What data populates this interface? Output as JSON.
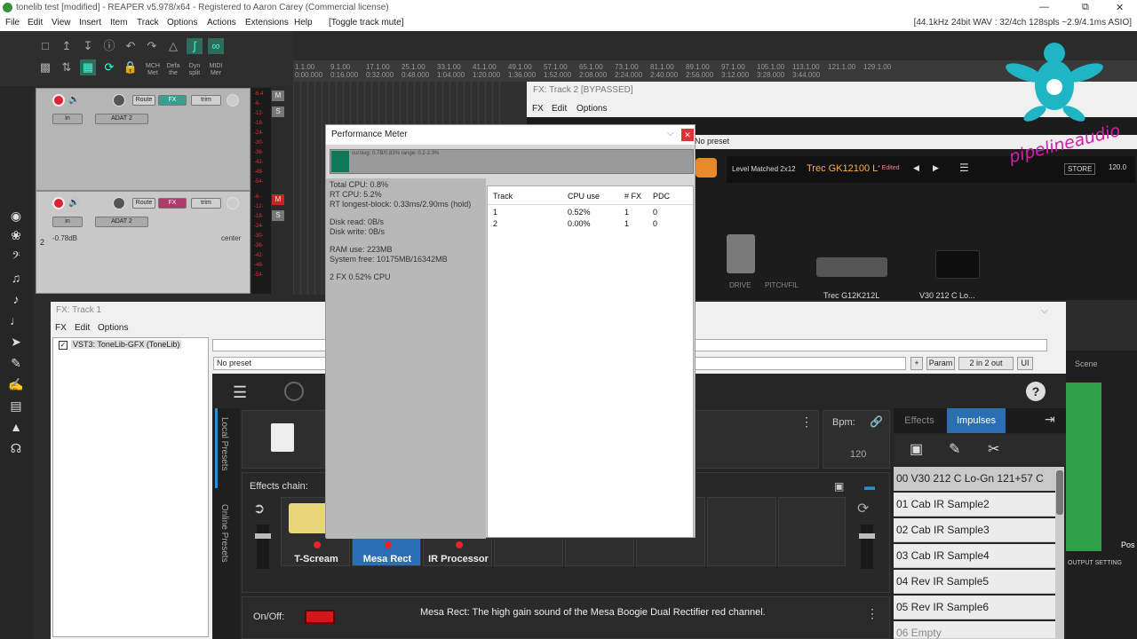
{
  "app": {
    "title": "tonelib test [modified] - REAPER v5.978/x64 - Registered to Aaron Carey (Commercial license)",
    "status": "[44.1kHz 24bit WAV : 32/4ch 128spls ~2.9/4.1ms ASIO]"
  },
  "menu": [
    "File",
    "Edit",
    "View",
    "Insert",
    "Item",
    "Track",
    "Options",
    "Actions",
    "Extensions",
    "Help",
    "[Toggle track mute]"
  ],
  "toolbar": {
    "mch": "MCH Met",
    "defa": "Defa the",
    "dyn": "Dyn split",
    "midi": "MIDI Mer"
  },
  "timeline": {
    "ticks": [
      {
        "bar": "1.1.00",
        "time": "0:00.000"
      },
      {
        "bar": "9.1.00",
        "time": "0:16.000"
      },
      {
        "bar": "17.1.00",
        "time": "0:32.000"
      },
      {
        "bar": "25.1.00",
        "time": "0:48.000"
      },
      {
        "bar": "33.1.00",
        "time": "1:04.000"
      },
      {
        "bar": "41.1.00",
        "time": "1:20.000"
      },
      {
        "bar": "49.1.00",
        "time": "1:36.000"
      },
      {
        "bar": "57.1.00",
        "time": "1:52.000"
      },
      {
        "bar": "65.1.00",
        "time": "2:08.000"
      },
      {
        "bar": "73.1.00",
        "time": "2:24.000"
      },
      {
        "bar": "81.1.00",
        "time": "2:40.000"
      },
      {
        "bar": "89.1.00",
        "time": "2:56.000"
      },
      {
        "bar": "97.1.00",
        "time": "3:12.000"
      },
      {
        "bar": "105.1.00",
        "time": "3:28.000"
      },
      {
        "bar": "113.1.00",
        "time": "3:44.000"
      },
      {
        "bar": "121.1.00",
        "time": ""
      },
      {
        "bar": "129.1.00",
        "time": ""
      }
    ]
  },
  "tracks": [
    {
      "num": "",
      "route": "Route",
      "fx": "FX",
      "trim": "trim",
      "input": "ADAT 2",
      "vol": "",
      "pan": "",
      "db": [
        "-6.4",
        "-6-",
        "-12-",
        "-18-",
        "-24-",
        "-30-",
        "-36-",
        "-42-",
        "-48-",
        "-54-"
      ]
    },
    {
      "num": "2",
      "route": "Route",
      "fx": "FX",
      "trim": "trim",
      "input": "ADAT 2",
      "vol": "-0.78dB",
      "pan": "center",
      "db": [
        "-6-",
        "-12-",
        "-18-",
        "-24-",
        "-30-",
        "-36-",
        "-42-",
        "-48-",
        "-54-"
      ]
    }
  ],
  "fx2": {
    "title": "FX: Track 2 [BYPASSED]",
    "menu": [
      "FX",
      "Edit",
      "Options"
    ],
    "preset": "No preset",
    "amp_label": "Level Matched 2x12",
    "amp_name": "Trec GK12100 L",
    "edited": "* Edited",
    "store": "STORE",
    "bpm": "120.0",
    "drive": "DRIVE",
    "pitch": "PITCH/FIL",
    "cab1": "Trec G12K212L",
    "cab2": "V30 212 C Lo..."
  },
  "logo": {
    "text": "pipelineaudio"
  },
  "fx1": {
    "title": "FX: Track 1",
    "menu": [
      "FX",
      "Edit",
      "Options"
    ],
    "plugin": "VST3: ToneLib-GFX (ToneLib)",
    "preset": "No preset",
    "plus": "+",
    "param": "Param",
    "io": "2 in 2 out",
    "ui": "UI",
    "local_presets": "Local Presets",
    "online_presets": "Online Presets",
    "bpm_label": "Bpm:",
    "bpm": "120",
    "chain_label": "Effects chain:",
    "chain": [
      {
        "name": "T-Scream"
      },
      {
        "name": "Mesa Rect"
      },
      {
        "name": "IR Processor"
      }
    ],
    "tabs": [
      "Effects",
      "Impulses"
    ],
    "impulses": [
      "00 V30 212 C Lo-Gn 121+57 C",
      "01 Cab IR Sample2",
      "02 Cab IR Sample3",
      "03 Cab IR Sample4",
      "04 Rev IR Sample5",
      "05 Rev IR Sample6",
      "06 Empty"
    ],
    "onoff": "On/Off:",
    "description": "Mesa Rect:  The high gain sound of the Mesa Boogie Dual Rectifier red channel.",
    "scene": "Scene",
    "output": "OUTPUT SETTING",
    "pos": "Pos"
  },
  "perf": {
    "title": "Performance Meter",
    "bar_text": "cur/avg: 0.7B/0.83%  range: 0.2-2.3%",
    "stats": [
      "Total CPU: 0.8%",
      "RT CPU: 5.2%",
      "RT longest-block: 0.33ms/2.90ms (hold)",
      "",
      "Disk read: 0B/s",
      "Disk write: 0B/s",
      "",
      "RAM use: 223MB",
      "System free: 10175MB/16342MB",
      "",
      "2 FX  0.52% CPU"
    ],
    "columns": [
      "Track",
      "CPU use",
      "# FX",
      "PDC"
    ],
    "rows": [
      [
        "1",
        "0.52%",
        "1",
        "0"
      ],
      [
        "2",
        "0.00%",
        "1",
        "0"
      ]
    ]
  },
  "colors": {
    "accent": "#1fb5c4",
    "chain_selected": "#2a6fb3",
    "rec": "#d23c3c"
  }
}
